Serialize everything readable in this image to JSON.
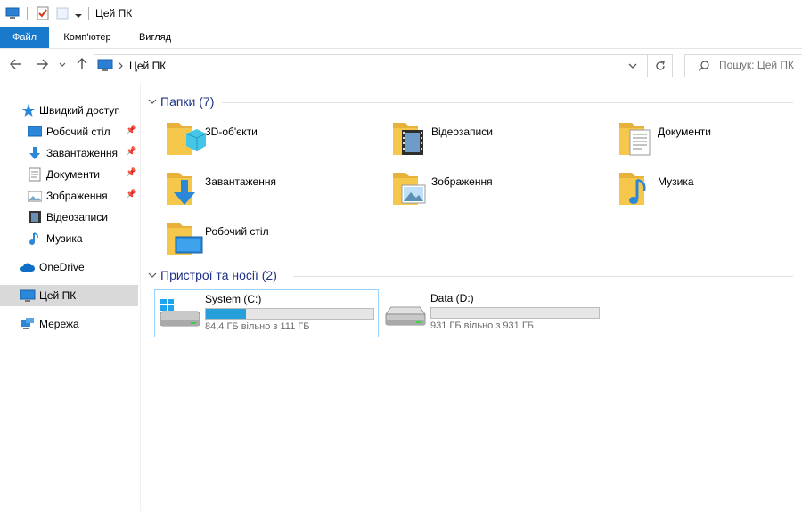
{
  "window": {
    "title": "Цей ПК"
  },
  "ribbon": {
    "tabs": [
      {
        "label": "Файл"
      },
      {
        "label": "Комп'ютер"
      },
      {
        "label": "Вигляд"
      }
    ]
  },
  "address": {
    "path": "Цей ПК"
  },
  "search": {
    "placeholder": "Пошук: Цей ПК"
  },
  "sidebar": {
    "items": [
      {
        "label": "Швидкий доступ",
        "icon": "star-icon"
      },
      {
        "label": "Робочий стіл",
        "icon": "desktop-icon",
        "pinned": true
      },
      {
        "label": "Завантаження",
        "icon": "download-icon",
        "pinned": true
      },
      {
        "label": "Документи",
        "icon": "document-icon",
        "pinned": true
      },
      {
        "label": "Зображення",
        "icon": "pictures-icon",
        "pinned": true
      },
      {
        "label": "Відеозаписи",
        "icon": "video-icon"
      },
      {
        "label": "Музика",
        "icon": "music-icon"
      },
      {
        "label": "OneDrive",
        "icon": "cloud-icon"
      },
      {
        "label": "Цей ПК",
        "icon": "computer-icon",
        "selected": true
      },
      {
        "label": "Мережа",
        "icon": "network-icon"
      }
    ]
  },
  "folders_group": {
    "title": "Папки (7)",
    "items": [
      {
        "name": "3D-об'єкти",
        "icon": "3d-objects-icon"
      },
      {
        "name": "Відеозаписи",
        "icon": "video-folder-icon"
      },
      {
        "name": "Документи",
        "icon": "documents-folder-icon"
      },
      {
        "name": "Завантаження",
        "icon": "downloads-folder-icon"
      },
      {
        "name": "Зображення",
        "icon": "pictures-folder-icon"
      },
      {
        "name": "Музика",
        "icon": "music-folder-icon"
      },
      {
        "name": "Робочий стіл",
        "icon": "desktop-folder-icon"
      }
    ]
  },
  "devices_group": {
    "title": "Пристрої та носії (2)",
    "items": [
      {
        "name": "System (C:)",
        "free_text": "84,4 ГБ вільно з 111 ГБ",
        "used_fraction": 0.24,
        "icon": "system-drive-icon"
      },
      {
        "name": "Data (D:)",
        "free_text": "931 ГБ вільно з 931 ГБ",
        "used_fraction": 0.0,
        "icon": "data-drive-icon"
      }
    ]
  },
  "colors": {
    "accent": "#1979ca",
    "group_header": "#1e3287",
    "usage_bar": "#26a0da",
    "folder": "#f5c84c"
  }
}
